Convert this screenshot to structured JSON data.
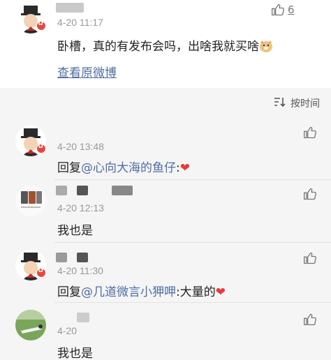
{
  "post": {
    "time": "4-20 11:17",
    "text": "卧槽，真的有发布会吗，出啥我就买啥",
    "emoji": "doge",
    "view_original": "查看原微博",
    "like_count": "6"
  },
  "sort_label": "按时间",
  "comments": [
    {
      "time": "4-20 13:48",
      "reply_prefix": "回复",
      "mention": "@心向大海的鱼仔",
      "suffix": ":",
      "emoji": "❤"
    },
    {
      "time": "4-20 12:13",
      "text": "我也是"
    },
    {
      "time": "4-20 11:30",
      "reply_prefix": "回复",
      "mention": "@几道微言小狎呷",
      "suffix": ":大量的",
      "emoji": "❤"
    },
    {
      "time": "4-20",
      "text": "我也是"
    }
  ]
}
